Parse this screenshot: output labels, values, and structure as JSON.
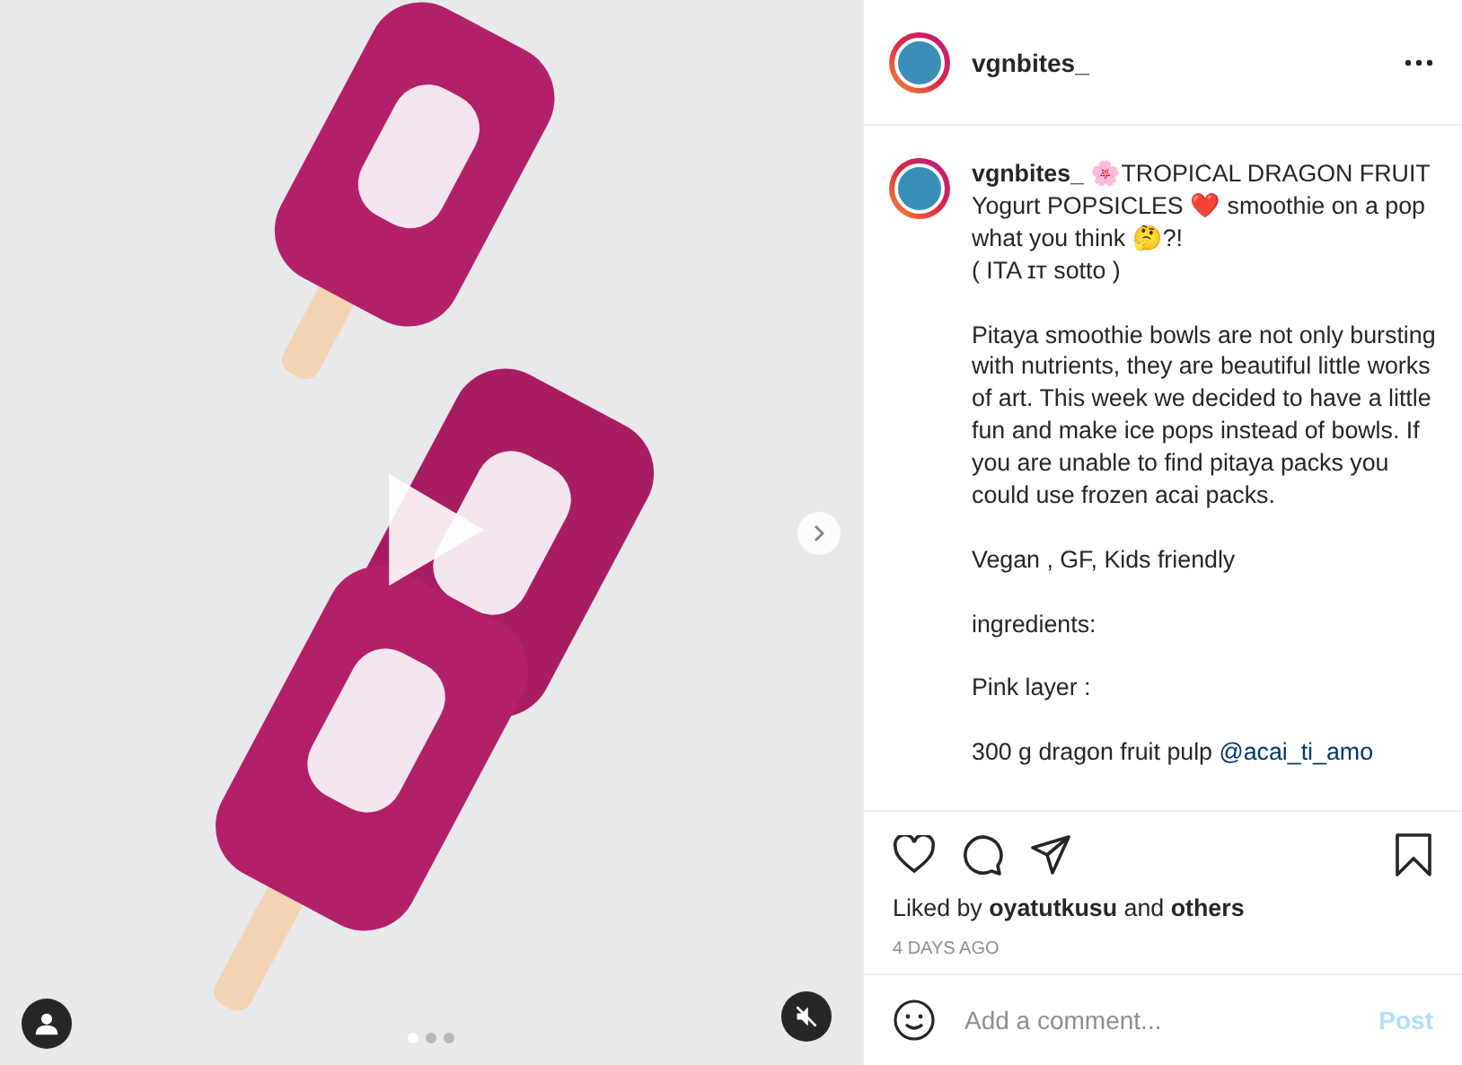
{
  "media": {
    "slides": [
      {
        "selected": true
      },
      {
        "selected": false
      },
      {
        "selected": false
      }
    ],
    "muted": true
  },
  "header": {
    "username": "vgnbites_"
  },
  "caption": {
    "username": "vgnbites_",
    "paragraphs": [
      "🌸TROPICAL DRAGON FRUIT Yogurt POPSICLES ❤️ smoothie on a pop what you think 🤔?!\n( ITA ɪᴛ sotto )",
      "Pitaya smoothie bowls are not only bursting with nutrients, they are beautiful little works of art. This week we decided to have a little fun and make ice pops instead of bowls. If you are unable to find pitaya packs you could use frozen acai packs.",
      "Vegan , GF, Kids friendly",
      "ingredients:",
      "Pink layer :"
    ],
    "last_line": {
      "text": "300 g dragon fruit pulp",
      "link": "@acai_ti_amo"
    }
  },
  "likes": "Liked by **oyatutkusu** and **others**",
  "time": "4 DAYS AGO",
  "comment": {
    "placeholder": "Add a comment...",
    "post": "Post"
  }
}
